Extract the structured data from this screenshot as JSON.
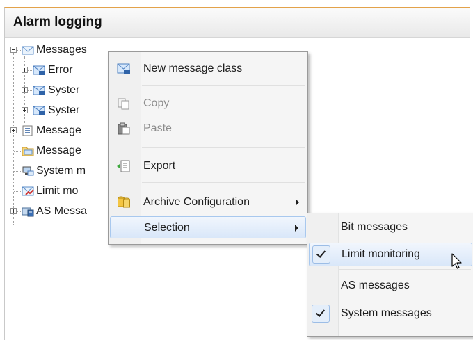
{
  "panel": {
    "title": "Alarm logging"
  },
  "tree": [
    {
      "label": "Messages",
      "icon": "envelope-icon"
    },
    {
      "label": "Error",
      "icon": "message-class-icon"
    },
    {
      "label": "Syster",
      "icon": "message-class-icon"
    },
    {
      "label": "Syster",
      "icon": "message-class-icon"
    },
    {
      "label": "Message",
      "icon": "message-block-icon"
    },
    {
      "label": "Message",
      "icon": "folder-icon"
    },
    {
      "label": "System m",
      "icon": "system-messages-icon"
    },
    {
      "label": "Limit mo",
      "icon": "limit-monitoring-icon"
    },
    {
      "label": "AS Messa",
      "icon": "as-messages-icon"
    }
  ],
  "context_menu": {
    "items": [
      {
        "label": "New message class",
        "enabled": true,
        "icon": "new-message-class-icon"
      },
      {
        "label": "Copy",
        "enabled": false,
        "icon": "copy-icon"
      },
      {
        "label": "Paste",
        "enabled": false,
        "icon": "paste-icon"
      },
      {
        "label": "Export",
        "enabled": true,
        "icon": "export-icon"
      },
      {
        "label": "Archive Configuration",
        "enabled": true,
        "icon": "archive-icon",
        "has_submenu": true
      },
      {
        "label": "Selection",
        "enabled": true,
        "highlighted": true,
        "has_submenu": true
      }
    ]
  },
  "selection_submenu": {
    "items": [
      {
        "label": "Bit messages",
        "checked": false
      },
      {
        "label": "Limit monitoring",
        "checked": true,
        "highlighted": true
      },
      {
        "label": "AS messages",
        "checked": false
      },
      {
        "label": "System messages",
        "checked": true
      }
    ]
  },
  "colors": {
    "accent_border": "#e3a24a",
    "highlight_border": "#a8c8ee",
    "highlight_fill": "#d9e7f9"
  }
}
